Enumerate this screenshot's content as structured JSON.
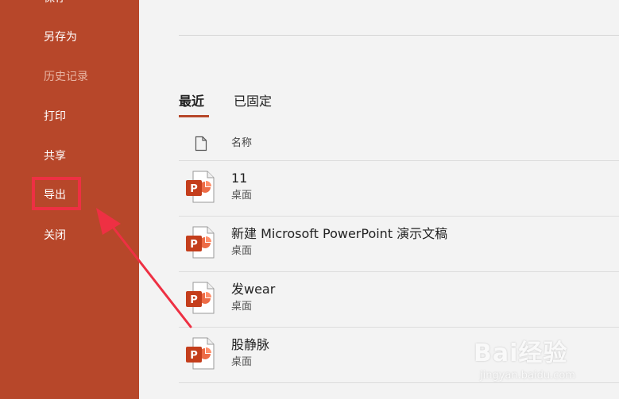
{
  "sidebar": {
    "items": [
      {
        "label": "保存",
        "disabled": false
      },
      {
        "label": "另存为",
        "disabled": false
      },
      {
        "label": "历史记录",
        "disabled": true
      },
      {
        "label": "打印",
        "disabled": false
      },
      {
        "label": "共享",
        "disabled": false
      },
      {
        "label": "导出",
        "disabled": false
      },
      {
        "label": "关闭",
        "disabled": false
      }
    ],
    "highlighted_item": "导出"
  },
  "tabs": [
    {
      "label": "最近",
      "active": true
    },
    {
      "label": "已固定",
      "active": false
    }
  ],
  "list_header": {
    "name_label": "名称",
    "icon": "document-icon"
  },
  "files": [
    {
      "name": "11",
      "location": "桌面",
      "icon": "powerpoint-file-icon"
    },
    {
      "name": "新建 Microsoft PowerPoint 演示文稿",
      "location": "桌面",
      "icon": "powerpoint-file-icon"
    },
    {
      "name": "发wear",
      "location": "桌面",
      "icon": "powerpoint-file-icon"
    },
    {
      "name": "股静脉",
      "location": "桌面",
      "icon": "powerpoint-file-icon"
    }
  ],
  "watermark": {
    "brand": "Bai经验",
    "url": "jingyan.baidu.com"
  },
  "colors": {
    "sidebar_bg": "#b7472a",
    "content_bg": "#f3f3f3",
    "accent": "#b7472a",
    "annotation_red": "#ee3043"
  }
}
